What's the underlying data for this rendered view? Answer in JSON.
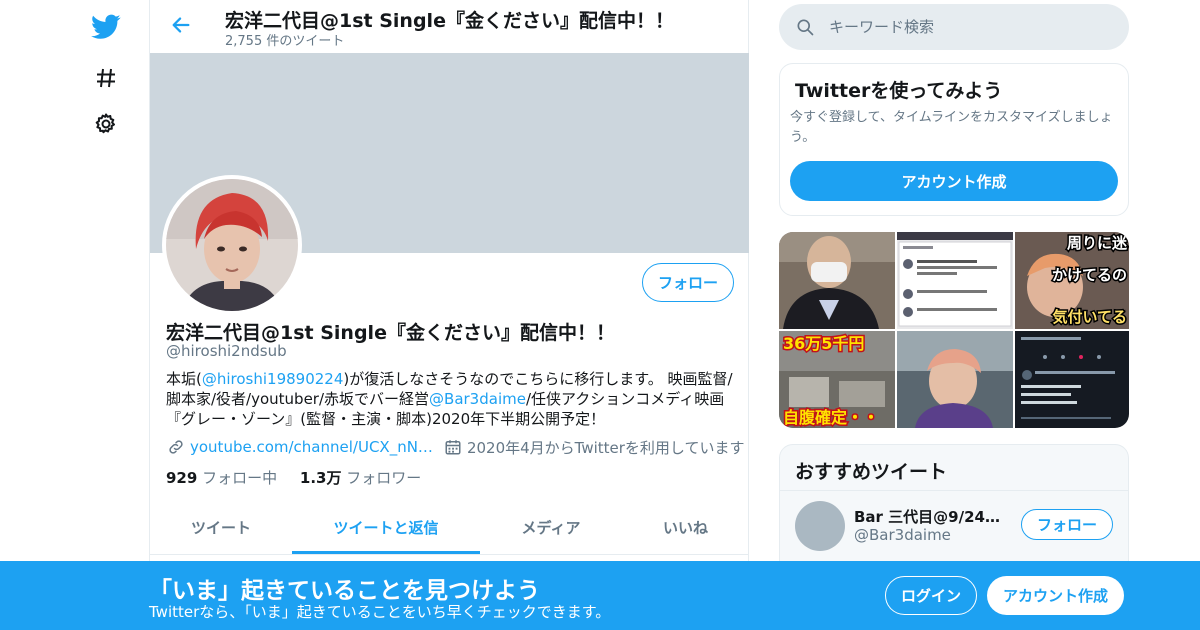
{
  "colors": {
    "accent": "#1da1f2",
    "text": "#14171a",
    "muted": "#657786",
    "banner": "#ccd6dd"
  },
  "nav": {
    "icons": [
      "twitter-bird-icon",
      "hashtag-icon",
      "gear-icon"
    ]
  },
  "header": {
    "title": "宏洋二代目@1st Single『金ください』配信中！！",
    "tweet_count": "2,755 件のツイート"
  },
  "profile": {
    "follow_label": "フォロー",
    "name": "宏洋二代目@1st Single『金ください』配信中！！",
    "handle": "@hiroshi2ndsub",
    "bio": {
      "part1": "本垢(",
      "mention1": "@hiroshi19890224",
      "part2": ")が復活しなさそうなのでこちらに移行します。 映画監督/脚本家/役者/youtuber/赤坂でバー経営",
      "mention2": "@Bar3daime",
      "part3": "/任侠アクションコメディ映画『グレー・ゾーン』(監督・主演・脚本)2020年下半期公開予定！"
    },
    "url": "youtube.com/channel/UCX_nN…",
    "joined": "2020年4月からTwitterを利用しています",
    "following_count": "929",
    "following_label": "フォロー中",
    "followers_count": "1.3万",
    "followers_label": "フォロワー"
  },
  "tabs": [
    {
      "label": "ツイート",
      "active": false
    },
    {
      "label": "ツイートと返信",
      "active": true
    },
    {
      "label": "メディア",
      "active": false
    },
    {
      "label": "いいね",
      "active": false
    }
  ],
  "search": {
    "placeholder": "キーワード検索"
  },
  "try_card": {
    "title": "Twitterを使ってみよう",
    "description": "今すぐ登録して、タイムラインをカスタマイズしましょう。",
    "button": "アカウント作成"
  },
  "media": {
    "caption_top_right_1": "周りに迷",
    "caption_top_right_2": "かけてるの",
    "caption_top_right_3": "気付いてる",
    "caption_bottom_left_1": "36万5千円",
    "caption_bottom_left_2": "自腹確定・・"
  },
  "recommended": {
    "title": "おすすめツイート",
    "name": "Bar 三代目@9/24出…",
    "handle": "@Bar3daime",
    "follow_label": "フォロー"
  },
  "bottom_bar": {
    "title": "「いま」起きていることを見つけよう",
    "subtitle": "Twitterなら、「いま」起きていることをいち早くチェックできます。",
    "login": "ログイン",
    "signup": "アカウント作成"
  }
}
